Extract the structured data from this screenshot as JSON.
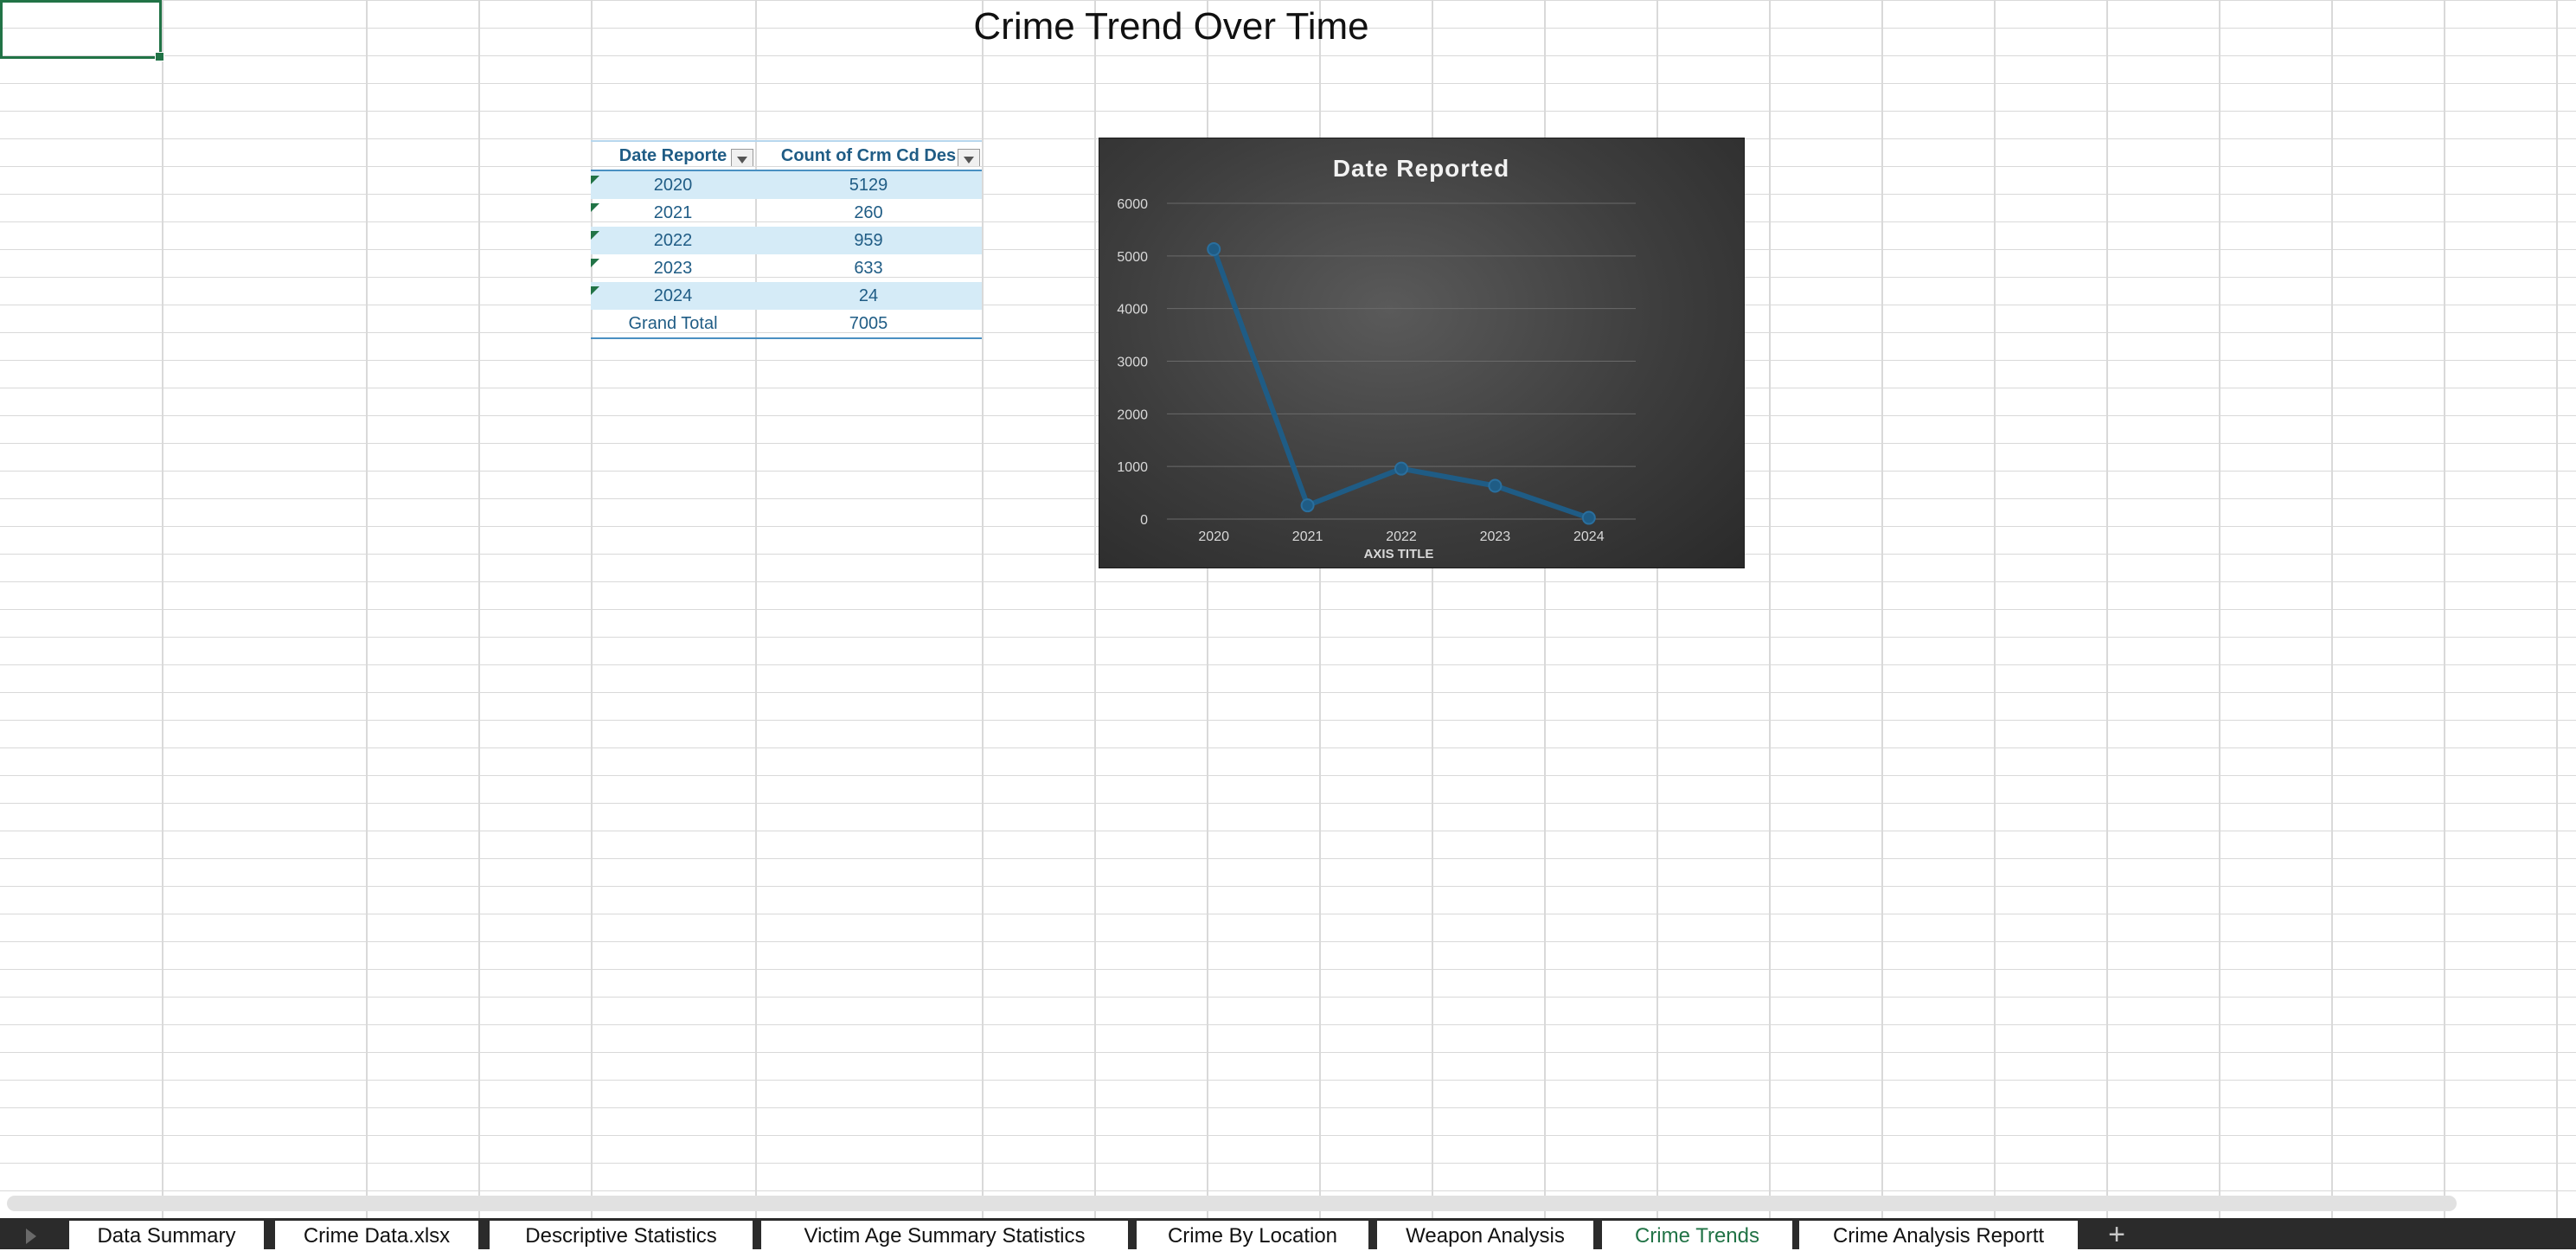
{
  "sheet": {
    "title": "Crime Trend Over Time"
  },
  "pivot": {
    "headers": [
      "Date Reporte",
      "Count of Crm Cd Des"
    ],
    "rows": [
      {
        "year": "2020",
        "count": "5129"
      },
      {
        "year": "2021",
        "count": "260"
      },
      {
        "year": "2022",
        "count": "959"
      },
      {
        "year": "2023",
        "count": "633"
      },
      {
        "year": "2024",
        "count": "24"
      }
    ],
    "total_label": "Grand Total",
    "total_value": "7005"
  },
  "chart_data": {
    "type": "line",
    "title": "Date Reported",
    "xlabel": "AXIS TITLE",
    "ylabel": "",
    "categories": [
      "2020",
      "2021",
      "2022",
      "2023",
      "2024"
    ],
    "values": [
      5129,
      260,
      959,
      633,
      24
    ],
    "ylim": [
      0,
      6000
    ],
    "yticks": [
      "0",
      "1000",
      "2000",
      "3000",
      "4000",
      "5000",
      "6000"
    ],
    "grid": true,
    "colors": {
      "line": "#1f5c85",
      "background": "#3d3d3d"
    }
  },
  "tabs": [
    {
      "label": "Data Summary",
      "active": false
    },
    {
      "label": "Crime Data.xlsx",
      "active": false
    },
    {
      "label": "Descriptive Statistics",
      "active": false
    },
    {
      "label": "Victim Age Summary Statistics",
      "active": false
    },
    {
      "label": "Crime By Location",
      "active": false
    },
    {
      "label": "Weapon Analysis",
      "active": false
    },
    {
      "label": "Crime Trends",
      "active": true
    },
    {
      "label": "Crime Analysis Reportt",
      "active": false
    }
  ],
  "tab_add_label": "+",
  "colors": {
    "accent": "#217346"
  }
}
